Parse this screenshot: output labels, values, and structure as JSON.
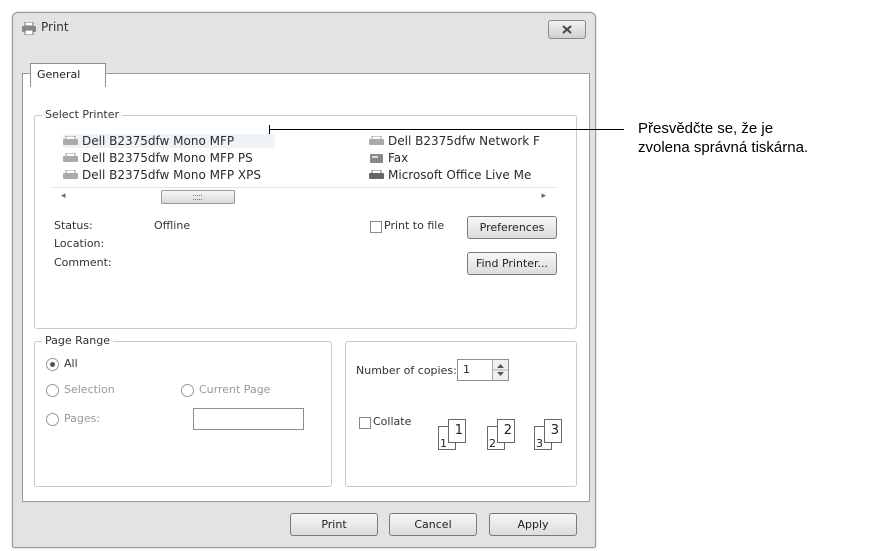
{
  "window": {
    "title": "Print"
  },
  "tabs": [
    {
      "label": "General"
    }
  ],
  "select_printer": {
    "label": "Select Printer",
    "printers": [
      {
        "name": "Dell B2375dfw Mono MFP"
      },
      {
        "name": "Dell B2375dfw Mono MFP PS"
      },
      {
        "name": "Dell B2375dfw Mono MFP XPS"
      },
      {
        "name": "Dell B2375dfw Network F"
      },
      {
        "name": "Fax"
      },
      {
        "name": "Microsoft Office Live Me"
      }
    ],
    "scroll_left": "◂",
    "scroll_right": "▸"
  },
  "status": {
    "status_label": "Status:",
    "status_value": "Offline",
    "location_label": "Location:",
    "comment_label": "Comment:"
  },
  "print_to_file": {
    "label": "Print to file",
    "checked": false
  },
  "buttons": {
    "preferences": "Preferences",
    "find_printer": "Find Printer...",
    "print": "Print",
    "cancel": "Cancel",
    "apply": "Apply"
  },
  "page_range": {
    "label": "Page Range",
    "all": "All",
    "selection": "Selection",
    "current_page": "Current Page",
    "pages": "Pages:",
    "pages_value": "",
    "selected": "All"
  },
  "copies": {
    "label": "Number of copies:",
    "value": "1",
    "collate_label": "Collate",
    "collate_checked": false,
    "collate_pages": [
      "1",
      "1",
      "2",
      "2",
      "3",
      "3"
    ]
  },
  "callout": {
    "line1": "Přesvědčte se, že je",
    "line2": "zvolena správná tiskárna."
  }
}
